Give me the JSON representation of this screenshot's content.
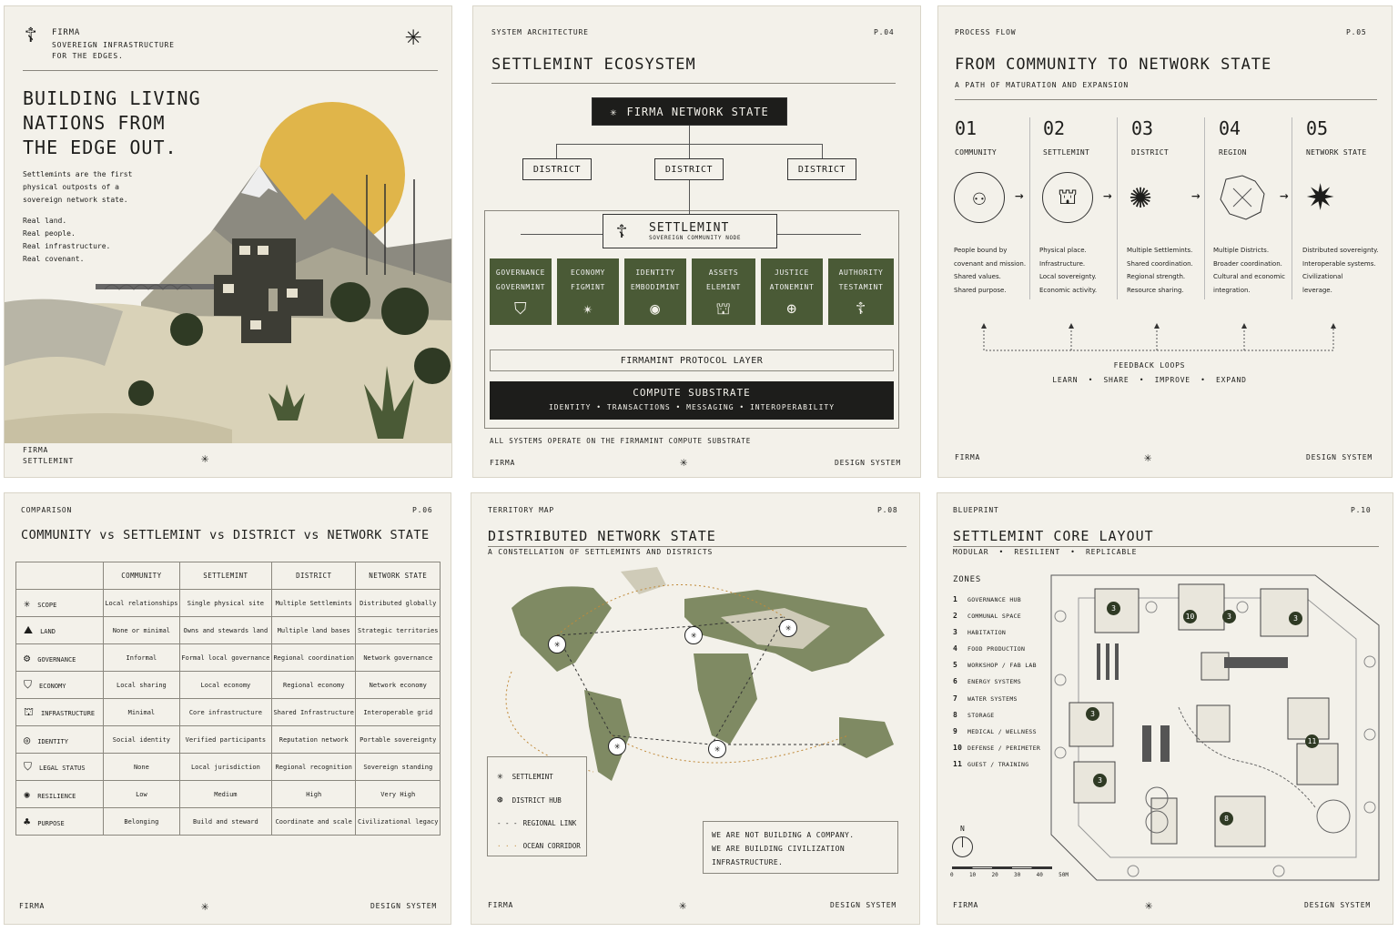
{
  "p1": {
    "brand": "FIRMA",
    "tag1": "SOVEREIGN INFRASTRUCTURE",
    "tag2": "FOR THE EDGES.",
    "h1": "BUILDING LIVING",
    "h2": "NATIONS FROM",
    "h3": "THE EDGE OUT.",
    "b1": "Settlemints are the first",
    "b2": "physical outposts of a",
    "b3": "sovereign network state.",
    "r1": "Real land.",
    "r2": "Real people.",
    "r3": "Real infrastructure.",
    "r4": "Real covenant.",
    "f1": "FIRMA",
    "f2": "SETTLEMINT"
  },
  "p2": {
    "label": "SYSTEM ARCHITECTURE",
    "page": "P.04",
    "title": "SETTLEMINT ECOSYSTEM",
    "top": "FIRMA NETWORK STATE",
    "districts": [
      "DISTRICT",
      "DISTRICT",
      "DISTRICT"
    ],
    "node": "SETTLEMINT",
    "node_sub": "SOVEREIGN COMMUNITY NODE",
    "modules": [
      {
        "a": "GOVERNANCE",
        "b": "GOVERNMINT"
      },
      {
        "a": "ECONOMY",
        "b": "FIGMINT"
      },
      {
        "a": "IDENTITY",
        "b": "EMBODIMINT"
      },
      {
        "a": "ASSETS",
        "b": "ELEMINT"
      },
      {
        "a": "JUSTICE",
        "b": "ATONEMINT"
      },
      {
        "a": "AUTHORITY",
        "b": "TESTAMINT"
      }
    ],
    "protocol": "FIRMAMINT PROTOCOL LAYER",
    "compute": "COMPUTE SUBSTRATE",
    "compute_sub": "IDENTITY • TRANSACTIONS • MESSAGING • INTEROPERABILITY",
    "note": "ALL SYSTEMS OPERATE ON THE FIRMAMINT COMPUTE SUBSTRATE",
    "f1": "FIRMA",
    "f2": "DESIGN SYSTEM"
  },
  "p3": {
    "label": "PROCESS FLOW",
    "page": "P.05",
    "title": "FROM COMMUNITY TO NETWORK STATE",
    "sub": "A PATH OF MATURATION AND EXPANSION",
    "steps": [
      {
        "n": "01",
        "t": "COMMUNITY",
        "d": [
          "People bound by",
          "covenant and mission.",
          "Shared values.",
          "Shared purpose."
        ]
      },
      {
        "n": "02",
        "t": "SETTLEMINT",
        "d": [
          "Physical place.",
          "Infrastructure.",
          "Local sovereignty.",
          "Economic activity."
        ]
      },
      {
        "n": "03",
        "t": "DISTRICT",
        "d": [
          "Multiple Settlemints.",
          "Shared coordination.",
          "Regional strength.",
          "Resource sharing."
        ]
      },
      {
        "n": "04",
        "t": "REGION",
        "d": [
          "Multiple Districts.",
          "Broader coordination.",
          "Cultural and economic",
          "integration."
        ]
      },
      {
        "n": "05",
        "t": "NETWORK STATE",
        "d": [
          "Distributed sovereignty.",
          "Interoperable systems.",
          "Civilizational",
          "leverage."
        ]
      }
    ],
    "loop": "FEEDBACK LOOPS",
    "loop_sub": "LEARN  •  SHARE  •  IMPROVE  •  EXPAND",
    "f1": "FIRMA",
    "f2": "DESIGN SYSTEM"
  },
  "p4": {
    "label": "COMPARISON",
    "page": "P.06",
    "title": "COMMUNITY vs SETTLEMINT vs DISTRICT vs NETWORK STATE",
    "cols": [
      "COMMUNITY",
      "SETTLEMINT",
      "DISTRICT",
      "NETWORK STATE"
    ],
    "rows": [
      {
        "k": "SCOPE",
        "v": [
          "Local relationships",
          "Single physical site",
          "Multiple Settlemints",
          "Distributed globally"
        ]
      },
      {
        "k": "LAND",
        "v": [
          "None or minimal",
          "Owns and stewards land",
          "Multiple land bases",
          "Strategic territories"
        ]
      },
      {
        "k": "GOVERNANCE",
        "v": [
          "Informal",
          "Formal local governance",
          "Regional coordination",
          "Network governance"
        ]
      },
      {
        "k": "ECONOMY",
        "v": [
          "Local sharing",
          "Local economy",
          "Regional economy",
          "Network economy"
        ]
      },
      {
        "k": "INFRASTRUCTURE",
        "v": [
          "Minimal",
          "Core infrastructure",
          "Shared Infrastructure",
          "Interoperable grid"
        ]
      },
      {
        "k": "IDENTITY",
        "v": [
          "Social identity",
          "Verified participants",
          "Reputation network",
          "Portable sovereignty"
        ]
      },
      {
        "k": "LEGAL STATUS",
        "v": [
          "None",
          "Local jurisdiction",
          "Regional recognition",
          "Sovereign standing"
        ]
      },
      {
        "k": "RESILIENCE",
        "v": [
          "Low",
          "Medium",
          "High",
          "Very High"
        ]
      },
      {
        "k": "PURPOSE",
        "v": [
          "Belonging",
          "Build and steward",
          "Coordinate and scale",
          "Civilizational legacy"
        ]
      }
    ],
    "f1": "FIRMA",
    "f2": "DESIGN SYSTEM"
  },
  "p5": {
    "label": "TERRITORY MAP",
    "page": "P.08",
    "title": "DISTRIBUTED NETWORK STATE",
    "sub": "A CONSTELLATION OF SETTLEMINTS AND DISTRICTS",
    "legend": [
      "SETTLEMINT",
      "DISTRICT HUB",
      "REGIONAL LINK",
      "OCEAN CORRIDOR"
    ],
    "q1": "WE ARE NOT BUILDING A COMPANY.",
    "q2": "WE ARE BUILDING CIVILIZATION",
    "q3": "INFRASTRUCTURE.",
    "f1": "FIRMA",
    "f2": "DESIGN SYSTEM"
  },
  "p6": {
    "label": "BLUEPRINT",
    "page": "P.10",
    "title": "SETTLEMINT CORE LAYOUT",
    "sub": "MODULAR  •  RESILIENT  •  REPLICABLE",
    "zones_h": "ZONES",
    "zones": [
      "GOVERNANCE HUB",
      "COMMUNAL SPACE",
      "HABITATION",
      "FOOD PRODUCTION",
      "WORKSHOP / FAB LAB",
      "ENERGY SYSTEMS",
      "WATER SYSTEMS",
      "STORAGE",
      "MEDICAL / WELLNESS",
      "DEFENSE / PERIMETER",
      "GUEST / TRAINING"
    ],
    "north": "N",
    "scale": [
      "0",
      "10",
      "20",
      "30",
      "40",
      "50M"
    ],
    "f1": "FIRMA",
    "f2": "DESIGN SYSTEM"
  },
  "colors": {
    "olive": "#4a5a36",
    "sun": "#e0b54a",
    "paper": "#f3f1ea",
    "ink": "#1d1d1b"
  }
}
